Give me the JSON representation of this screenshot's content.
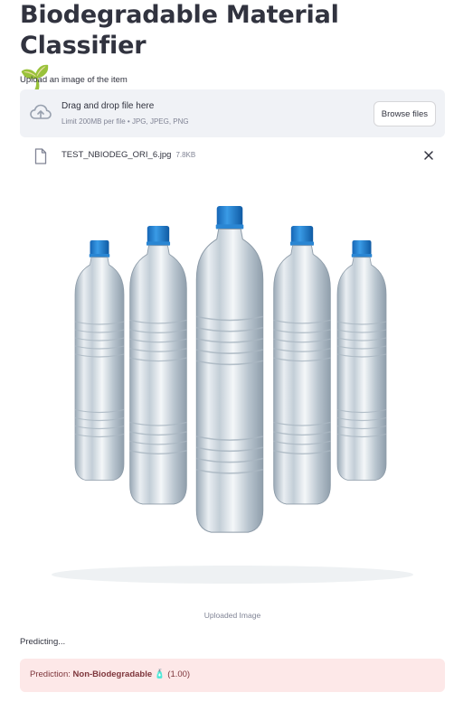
{
  "header": {
    "title": "Biodegradable Material Classifier",
    "title_emoji": "🌱"
  },
  "uploader": {
    "label": "Upload an image of the item",
    "drop_text": "Drag and drop file here",
    "limit_text": "Limit 200MB per file • JPG, JPEG, PNG",
    "browse_label": "Browse files",
    "icon": "cloud-upload-icon"
  },
  "file": {
    "name": "TEST_NBIODEG_ORI_6.jpg",
    "size": "7.8KB",
    "icon": "file-icon",
    "close_icon": "close-icon"
  },
  "image": {
    "caption": "Uploaded Image",
    "description_icon": "water-bottles-image"
  },
  "status": {
    "predicting": "Predicting..."
  },
  "prediction": {
    "prefix": "Prediction: ",
    "label": "Non-Biodegradable",
    "emoji": "🧴",
    "confidence": "(1.00)"
  },
  "colors": {
    "text": "#31333f",
    "muted": "#808495",
    "dropzone_bg": "#f0f2f6",
    "error_bg": "#fde8e8",
    "error_text": "#7d353b",
    "bottle_cap": "#1f7fd1"
  }
}
